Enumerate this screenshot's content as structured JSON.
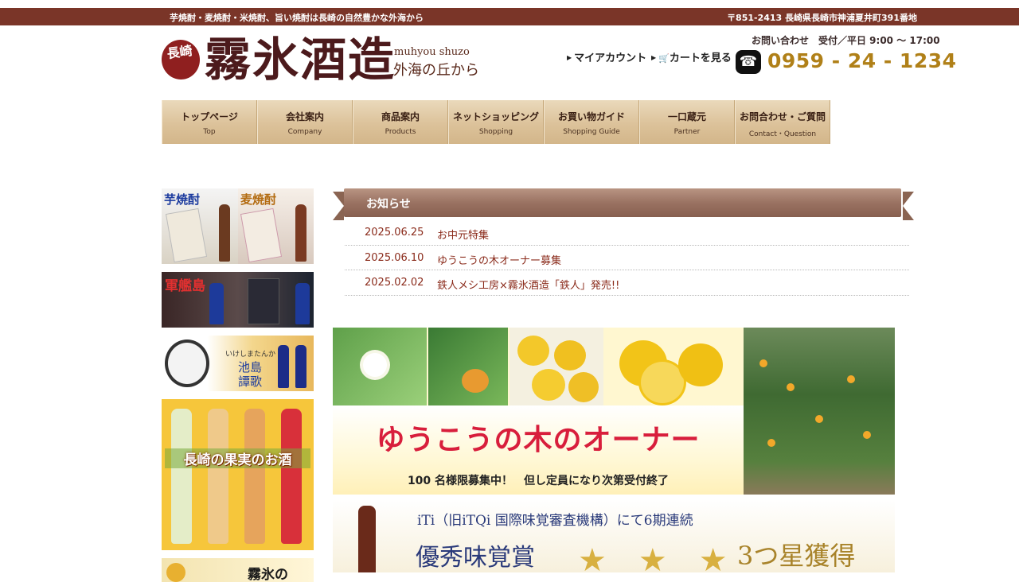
{
  "topbar": {
    "tagline": "芋焼酎・麦焼酎・米焼酎、旨い焼酎は長崎の自然豊かな外海から",
    "address": "〒851-2413 長崎県長崎市神浦夏井町391番地"
  },
  "logo": {
    "seal": "長崎",
    "name": "霧氷酒造",
    "romaji": "muhyou shuzo",
    "tagline": "外海の丘から"
  },
  "header_links": {
    "account": "マイアカウント",
    "cart": "カートを見る"
  },
  "contact": {
    "label": "お問い合わせ　受付／平日 9:00 ～ 17:00",
    "phone": "0959 - 24 - 1234"
  },
  "nav": [
    {
      "jp": "トップページ",
      "en": "Top"
    },
    {
      "jp": "会社案内",
      "en": "Company"
    },
    {
      "jp": "商品案内",
      "en": "Products"
    },
    {
      "jp": "ネットショッピング",
      "en": "Shopping"
    },
    {
      "jp": "お買い物ガイド",
      "en": "Shopping Guide"
    },
    {
      "jp": "一口蔵元",
      "en": "Partner"
    },
    {
      "jp": "お問合わせ・ご質問",
      "en": "Contact・Question"
    }
  ],
  "sidebar": {
    "imo": "芋焼酎",
    "mugi": "麦焼酎",
    "gunkanjima": "軍艦島",
    "ikeshima_small": "いけしまたんか",
    "ikeshima_1": "池島",
    "ikeshima_2": "譚歌",
    "fruit": "長崎の果実のお酒",
    "bottom": "霧氷の"
  },
  "news": {
    "title": "お知らせ",
    "items": [
      {
        "date": "2025.06.25",
        "text": "お中元特集"
      },
      {
        "date": "2025.06.10",
        "text": "ゆうこうの木オーナー募集"
      },
      {
        "date": "2025.02.02",
        "text": "鉄人メシ工房×霧氷酒造「鉄人」発売!!"
      }
    ]
  },
  "yuko_banner": {
    "headline": "ゆうこうの木のオーナー",
    "sub": "100 名様限募集中！　但し定員になり次第受付終了"
  },
  "award_banner": {
    "line1": "iTi（旧iTQi 国際味覚審査機構）にて6期連続",
    "line2": "優秀味覚賞",
    "stars": "★　★　★",
    "line3": "3つ星獲得"
  },
  "colors": {
    "topbar": "#7a3528",
    "phone": "#b08018",
    "news_text": "#8a2a1a",
    "yuko_headline": "#d81e3c"
  }
}
